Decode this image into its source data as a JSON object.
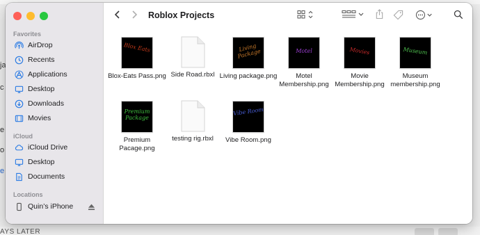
{
  "background": {
    "left_fragments": [
      "ja",
      "c",
      "e",
      "o",
      "e"
    ],
    "bottom_text": "AYS LATER"
  },
  "window": {
    "title": "Roblox Projects"
  },
  "sidebar": {
    "sections": [
      {
        "header": "Favorites",
        "items": [
          {
            "label": "AirDrop",
            "icon": "airdrop-icon"
          },
          {
            "label": "Recents",
            "icon": "clock-icon"
          },
          {
            "label": "Applications",
            "icon": "applications-icon"
          },
          {
            "label": "Desktop",
            "icon": "desktop-icon"
          },
          {
            "label": "Downloads",
            "icon": "downloads-icon"
          },
          {
            "label": "Movies",
            "icon": "movies-icon"
          }
        ]
      },
      {
        "header": "iCloud",
        "items": [
          {
            "label": "iCloud Drive",
            "icon": "cloud-icon"
          },
          {
            "label": "Desktop",
            "icon": "desktop-icon"
          },
          {
            "label": "Documents",
            "icon": "document-icon"
          }
        ]
      },
      {
        "header": "Locations",
        "items": [
          {
            "label": "Quin’s iPhone",
            "icon": "iphone-icon"
          }
        ]
      }
    ]
  },
  "files": [
    {
      "name": "Blox-Eats Pass.png",
      "kind": "image",
      "thumb_text": "Blox Eats",
      "thumb_color": "#c43a1a"
    },
    {
      "name": "Side Road.rbxl",
      "kind": "document"
    },
    {
      "name": "Living package.png",
      "kind": "image",
      "thumb_text": "Living Package",
      "thumb_color": "#c97a2a"
    },
    {
      "name": "Motel Membership.png",
      "kind": "image",
      "thumb_text": "Motel",
      "thumb_color": "#9b3fd0"
    },
    {
      "name": "Movie Membership.png",
      "kind": "image",
      "thumb_text": "Movies",
      "thumb_color": "#c42a2a"
    },
    {
      "name": "Museum membership.png",
      "kind": "image",
      "thumb_text": "Museum",
      "thumb_color": "#4fc04f"
    },
    {
      "name": "Premium Pacage.png",
      "kind": "image",
      "thumb_text": "Premium Package",
      "thumb_color": "#3fc03f"
    },
    {
      "name": "testing rig.rbxl",
      "kind": "document"
    },
    {
      "name": "Vibe Room.png",
      "kind": "image",
      "thumb_text": "Vibe Room",
      "thumb_color": "#4a5fd8"
    }
  ]
}
